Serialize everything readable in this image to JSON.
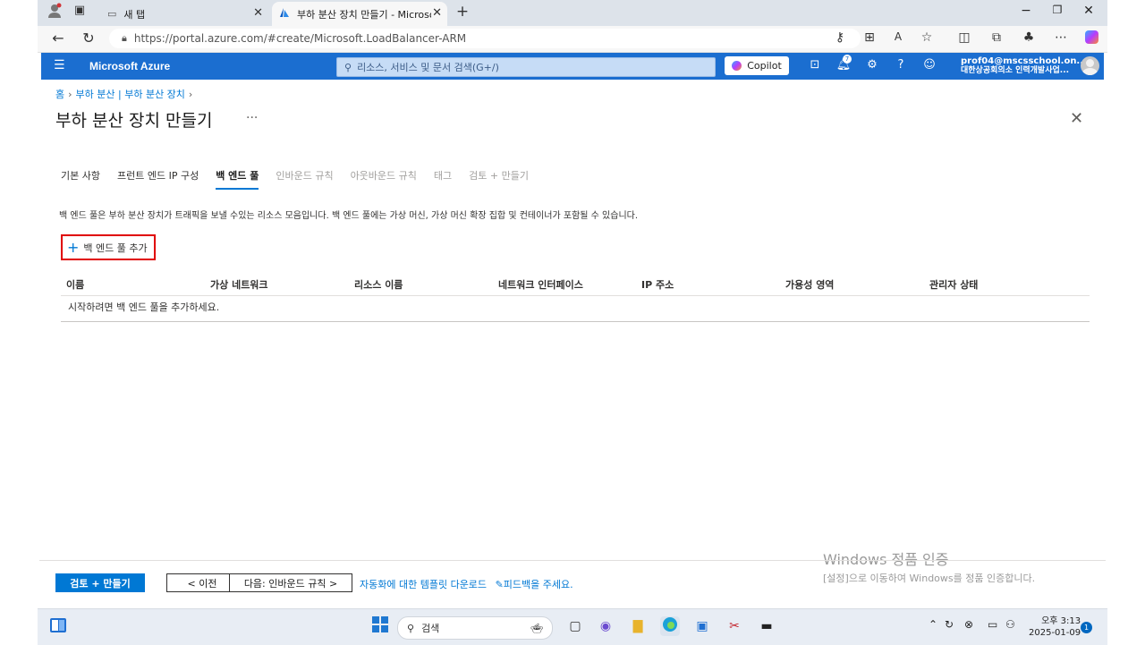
{
  "browser": {
    "tabs": [
      {
        "label": "새 탭"
      },
      {
        "label": "부하 분산 장치 만들기 - Microsoft"
      }
    ],
    "url": "https://portal.azure.com/#create/Microsoft.LoadBalancer-ARM"
  },
  "azure_header": {
    "brand": "Microsoft Azure",
    "search_placeholder": "리소스, 서비스 및 문서 검색(G+/)",
    "copilot_label": "Copilot",
    "notification_count": "7",
    "account_email": "prof04@mscsschool.on...",
    "account_org": "대한상공회의소 인력개발사업..."
  },
  "breadcrumb": [
    "홈",
    "부하 분산 | 부하 분산 장치"
  ],
  "page_title": "부하 분산 장치 만들기",
  "tabs": [
    {
      "label": "기본 사항",
      "state": "normal"
    },
    {
      "label": "프런트 엔드 IP 구성",
      "state": "normal"
    },
    {
      "label": "백 엔드 풀",
      "state": "active"
    },
    {
      "label": "인바운드 규칙",
      "state": "disabled"
    },
    {
      "label": "아웃바운드 규칙",
      "state": "disabled"
    },
    {
      "label": "태그",
      "state": "disabled"
    },
    {
      "label": "검토 + 만들기",
      "state": "disabled"
    }
  ],
  "description": "백 엔드 풀은 부하 분산 장치가 트래픽을 보낼 수있는 리소스 모음입니다. 백 엔드 풀에는 가상 머신, 가상 머신 확장 집합 및 컨테이너가 포함될 수 있습니다.",
  "add_button_label": "백 엔드 풀 추가",
  "grid": {
    "columns": [
      "이름",
      "가상 네트워크",
      "리소스 이름",
      "네트워크 인터페이스",
      "IP 주소",
      "가용성 영역",
      "관리자 상태"
    ],
    "empty_message": "시작하려면 백 엔드 풀을 추가하세요."
  },
  "footer": {
    "review_create": "검토 + 만들기",
    "previous": "< 이전",
    "next": "다음: 인바운드 규칙 >",
    "template_link": "자동화에 대한 템플릿 다운로드",
    "feedback_link": "피드백을 주세요."
  },
  "watermark": {
    "line1": "Windows 정품 인증",
    "line2": "[설정]으로 이동하여 Windows를 정품 인증합니다."
  },
  "taskbar": {
    "search_placeholder": "검색",
    "time": "오후 3:13",
    "date": "2025-01-09",
    "notification_count": "1"
  },
  "colors": {
    "azure_blue": "#1b6ed0",
    "accent": "#0078d4",
    "highlight_box": "#e00000"
  }
}
